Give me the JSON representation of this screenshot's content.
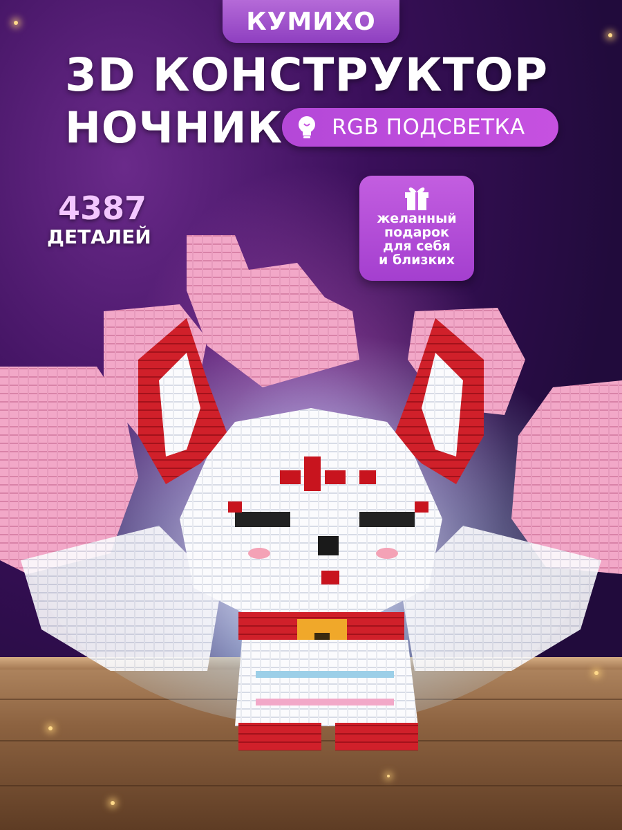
{
  "badge": {
    "label": "КУМИХО"
  },
  "headline": {
    "line1": "3D КОНСТРУКТОР",
    "line2": "НОЧНИК"
  },
  "feature_pill": {
    "text": "RGB ПОДСВЕТКА",
    "icon": "lightbulb-icon"
  },
  "parts": {
    "count": "4387",
    "label": "ДЕТАЛЕЙ"
  },
  "gift": {
    "icon": "gift-icon",
    "lines": [
      "желанный",
      "подарок",
      "для себя",
      "и близких"
    ]
  },
  "colors": {
    "accent_purple": "#b448d8",
    "count_color": "#f3c6ff",
    "fox_white": "#ffffff",
    "fox_red": "#d0202a",
    "fox_pink": "#f2a8c8",
    "floor": "#8c6240"
  }
}
